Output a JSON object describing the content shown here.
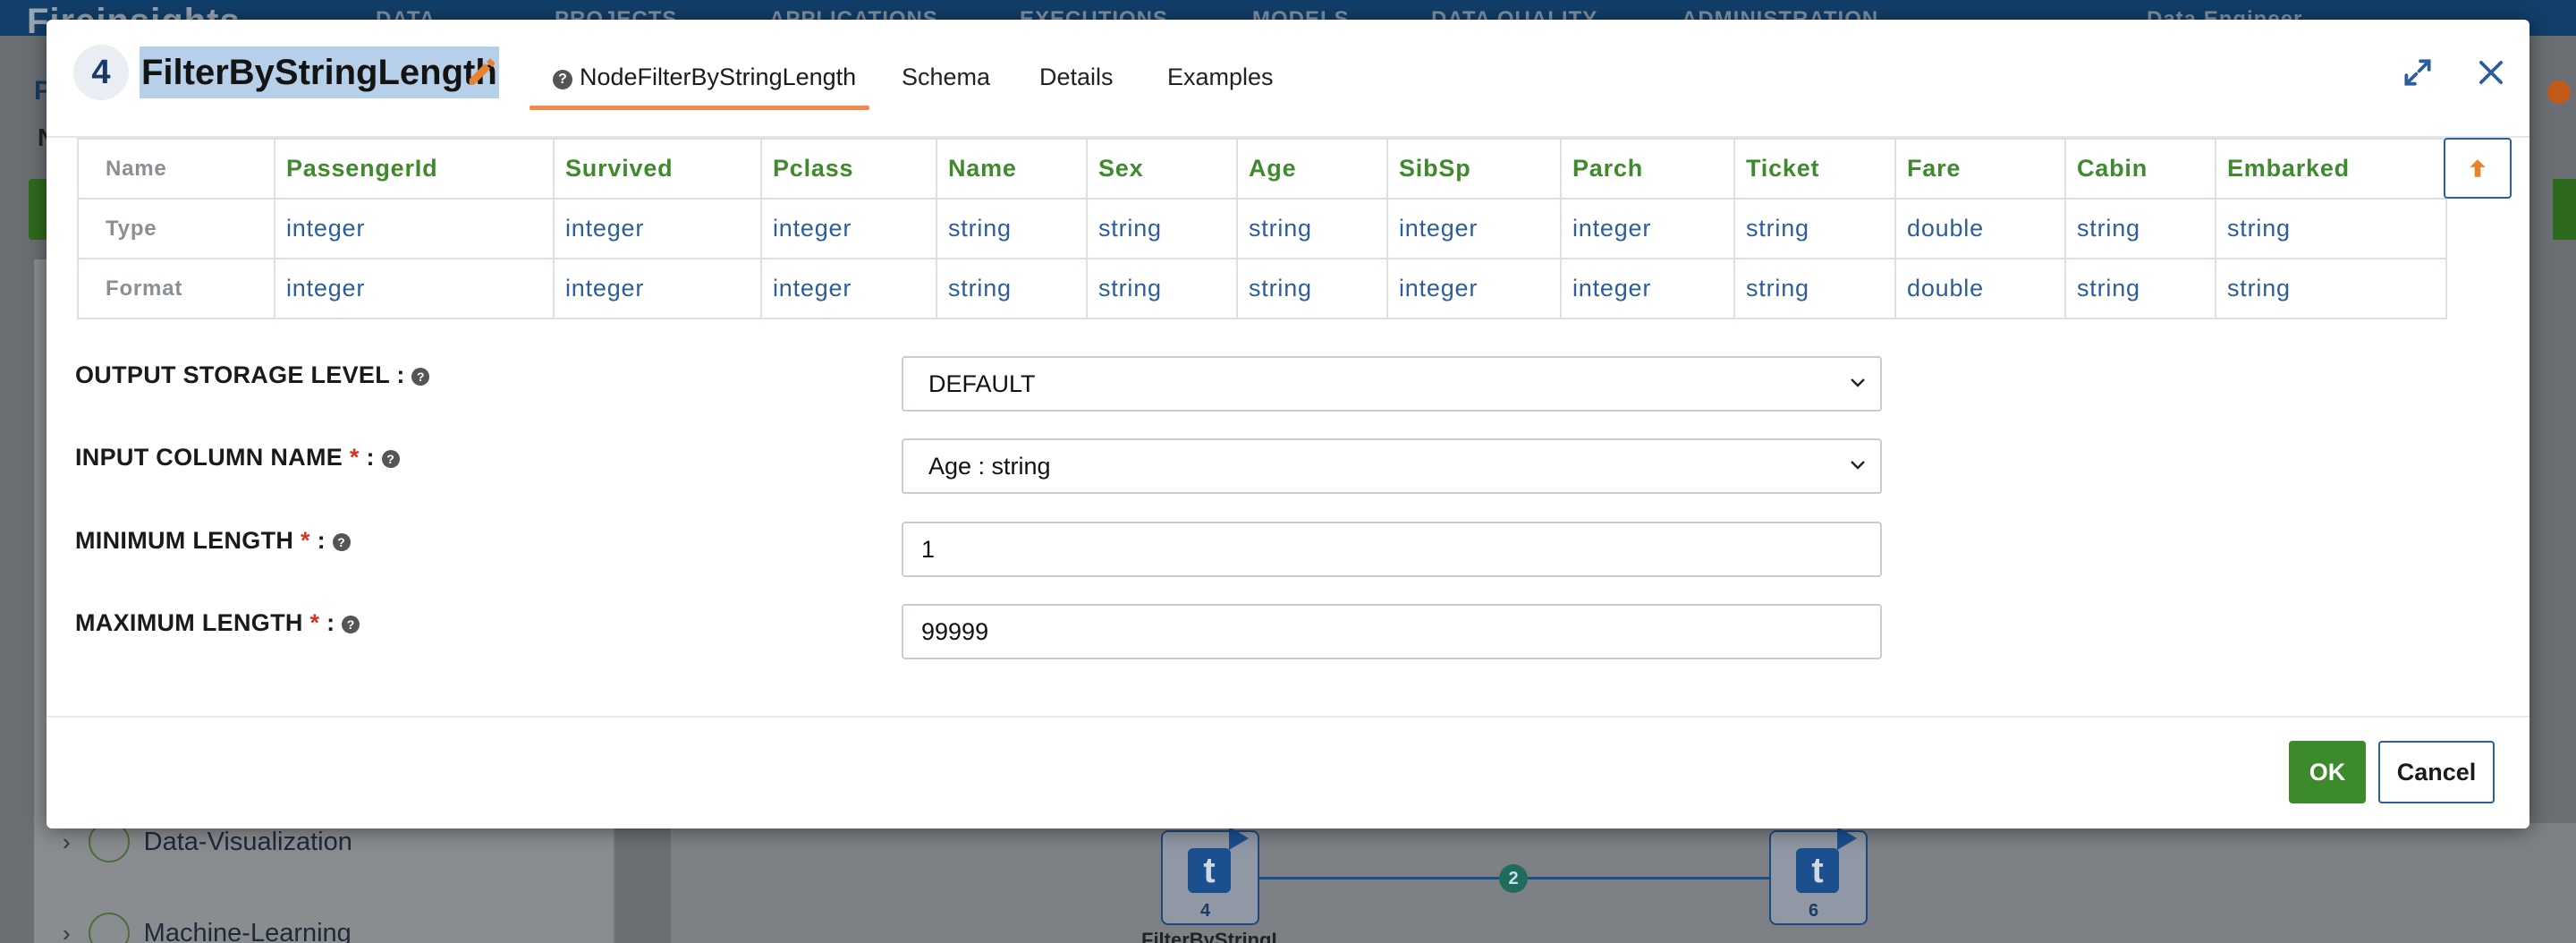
{
  "background": {
    "logo": "Fireinsights",
    "nav": [
      "DATA",
      "PROJECTS",
      "APPLICATIONS",
      "EXECUTIONS",
      "MODELS",
      "DATA QUALITY",
      "ADMINISTRATION"
    ],
    "user": "Data Engineer",
    "sidebar_items": [
      "Data-Visualization",
      "Machine-Learning"
    ],
    "nodes": [
      {
        "number": "4",
        "label": "FilterByStringL"
      },
      {
        "number": "6",
        "label": ""
      }
    ],
    "edge_badge": "2"
  },
  "modal": {
    "node_number": "4",
    "title": "FilterByStringLength",
    "tabs": [
      "NodeFilterByStringLength",
      "Schema",
      "Details",
      "Examples"
    ],
    "active_tab": "NodeFilterByStringLength",
    "schema": {
      "row_headers": [
        "Name",
        "Type",
        "Format"
      ],
      "columns": [
        {
          "name": "PassengerId",
          "type": "integer",
          "format": "integer"
        },
        {
          "name": "Survived",
          "type": "integer",
          "format": "integer"
        },
        {
          "name": "Pclass",
          "type": "integer",
          "format": "integer"
        },
        {
          "name": "Name",
          "type": "string",
          "format": "string"
        },
        {
          "name": "Sex",
          "type": "string",
          "format": "string"
        },
        {
          "name": "Age",
          "type": "string",
          "format": "string"
        },
        {
          "name": "SibSp",
          "type": "integer",
          "format": "integer"
        },
        {
          "name": "Parch",
          "type": "integer",
          "format": "integer"
        },
        {
          "name": "Ticket",
          "type": "string",
          "format": "string"
        },
        {
          "name": "Fare",
          "type": "double",
          "format": "double"
        },
        {
          "name": "Cabin",
          "type": "string",
          "format": "string"
        },
        {
          "name": "Embarked",
          "type": "string",
          "format": "string"
        }
      ]
    },
    "form": {
      "storage_level": {
        "label": "OUTPUT STORAGE LEVEL",
        "value": "DEFAULT"
      },
      "input_column": {
        "label": "INPUT COLUMN NAME",
        "value": "Age : string"
      },
      "min_length": {
        "label": "MINIMUM LENGTH",
        "value": "1"
      },
      "max_length": {
        "label": "MAXIMUM LENGTH",
        "value": "99999"
      }
    },
    "ok_label": "OK",
    "cancel_label": "Cancel"
  },
  "colors": {
    "accent_green": "#3d8a2c",
    "accent_blue": "#2d5e99",
    "tab_underline": "#f08a4b",
    "required": "#d9341e"
  }
}
